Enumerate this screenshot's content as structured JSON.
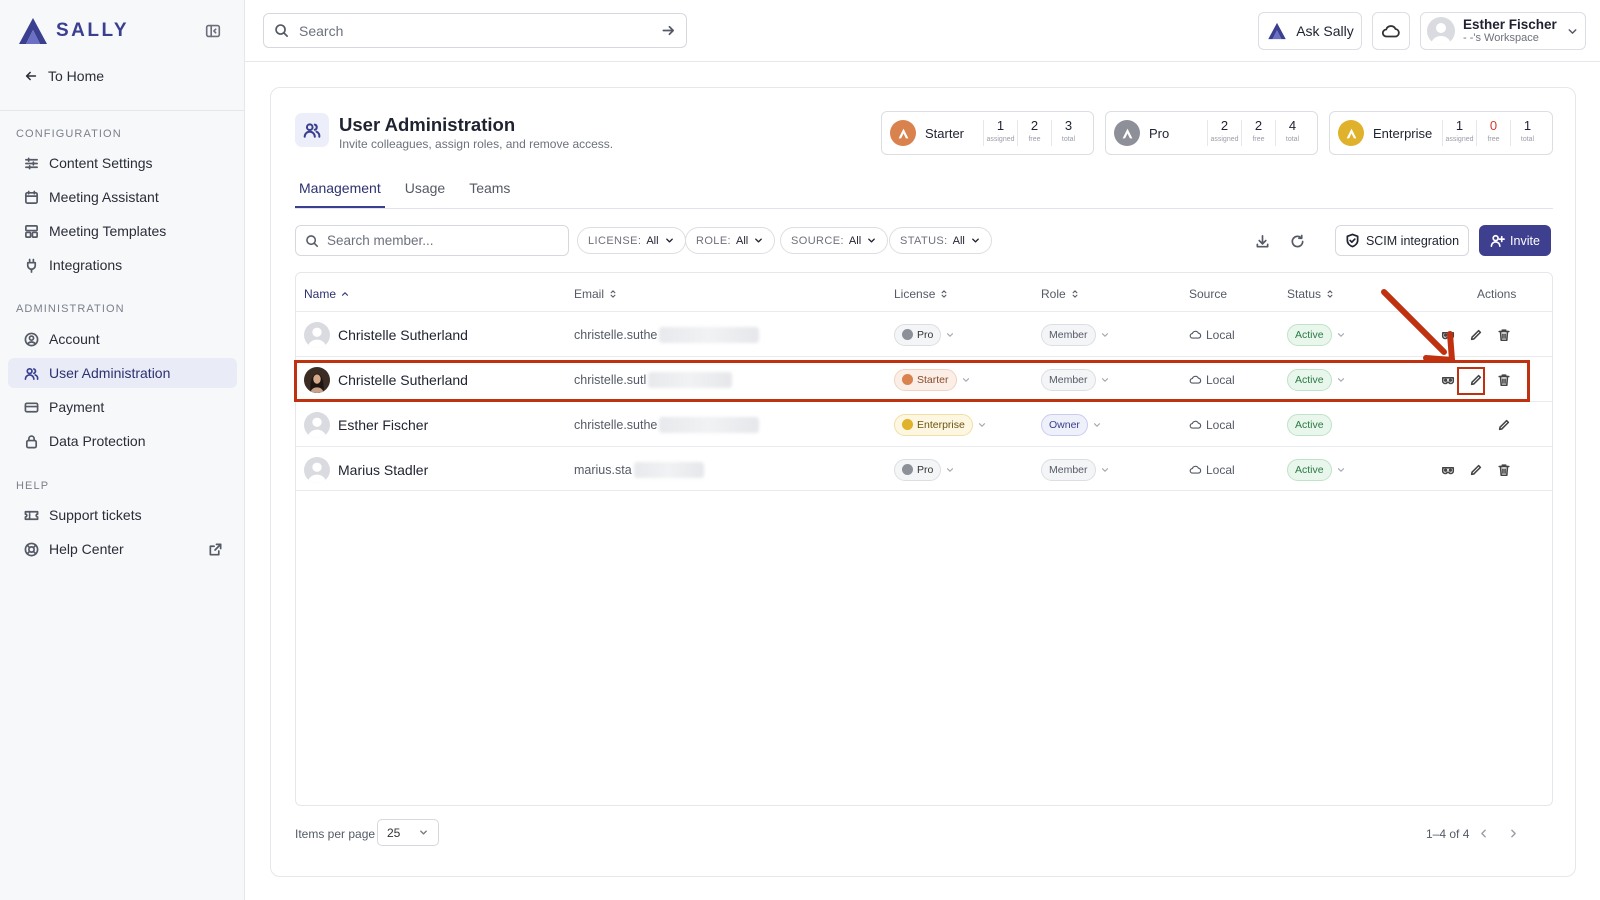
{
  "brand": {
    "name": "SALLY",
    "logo_icon": "sally-logo-icon"
  },
  "sidebar": {
    "back_label": "To Home",
    "sections": [
      {
        "label": "CONFIGURATION",
        "items": [
          {
            "label": "Content Settings",
            "icon": "sliders-icon"
          },
          {
            "label": "Meeting Assistant",
            "icon": "calendar-icon"
          },
          {
            "label": "Meeting Templates",
            "icon": "template-icon"
          },
          {
            "label": "Integrations",
            "icon": "plug-icon"
          }
        ]
      },
      {
        "label": "ADMINISTRATION",
        "items": [
          {
            "label": "Account",
            "icon": "user-circle-icon"
          },
          {
            "label": "User Administration",
            "icon": "users-icon",
            "active": true
          },
          {
            "label": "Payment",
            "icon": "credit-card-icon"
          },
          {
            "label": "Data Protection",
            "icon": "lock-icon"
          }
        ]
      },
      {
        "label": "HELP",
        "items": [
          {
            "label": "Support tickets",
            "icon": "ticket-icon"
          },
          {
            "label": "Help Center",
            "icon": "lifebuoy-icon"
          }
        ]
      }
    ]
  },
  "topbar": {
    "search_placeholder": "Search",
    "ask_label": "Ask Sally",
    "user": {
      "name": "Esther Fischer",
      "workspace": "- -'s Workspace"
    }
  },
  "page": {
    "title": "User Administration",
    "subtitle": "Invite colleagues, assign roles, and remove access."
  },
  "licenses": [
    {
      "name": "Starter",
      "assigned": "1",
      "free": "2",
      "total": "3",
      "color": "#d9824e"
    },
    {
      "name": "Pro",
      "assigned": "2",
      "free": "2",
      "total": "4",
      "color": "#8d9099"
    },
    {
      "name": "Enterprise",
      "assigned": "1",
      "free": "0",
      "total": "1",
      "color": "#e0b12a"
    }
  ],
  "license_stat_labels": {
    "assigned": "assigned",
    "free": "free",
    "total": "total"
  },
  "tabs": [
    "Management",
    "Usage",
    "Teams"
  ],
  "toolbar": {
    "member_search_placeholder": "Search member...",
    "filters": [
      {
        "label": "LICENSE:",
        "value": "All"
      },
      {
        "label": "ROLE:",
        "value": "All"
      },
      {
        "label": "SOURCE:",
        "value": "All"
      },
      {
        "label": "STATUS:",
        "value": "All"
      }
    ],
    "scim_label": "SCIM integration",
    "invite_label": "Invite"
  },
  "table": {
    "columns": {
      "name": "Name",
      "email": "Email",
      "license": "License",
      "role": "Role",
      "source": "Source",
      "status": "Status",
      "actions": "Actions"
    },
    "rows": [
      {
        "name": "Christelle Sutherland",
        "email": "christelle.suthe",
        "license": "Pro",
        "role": "Member",
        "source": "Local",
        "status": "Active"
      },
      {
        "name": "Christelle Sutherland",
        "email": "christelle.sutl",
        "license": "Starter",
        "role": "Member",
        "source": "Local",
        "status": "Active"
      },
      {
        "name": "Esther Fischer",
        "email": "christelle.suthe",
        "license": "Enterprise",
        "role": "Owner",
        "source": "Local",
        "status": "Active"
      },
      {
        "name": "Marius Stadler",
        "email": "marius.sta",
        "license": "Pro",
        "role": "Member",
        "source": "Local",
        "status": "Active"
      }
    ]
  },
  "footer": {
    "items_per_page_label": "Items per page",
    "per_page_value": "25",
    "range": "1–4 of 4"
  },
  "annotation": {
    "highlight_color": "#c0310f"
  }
}
